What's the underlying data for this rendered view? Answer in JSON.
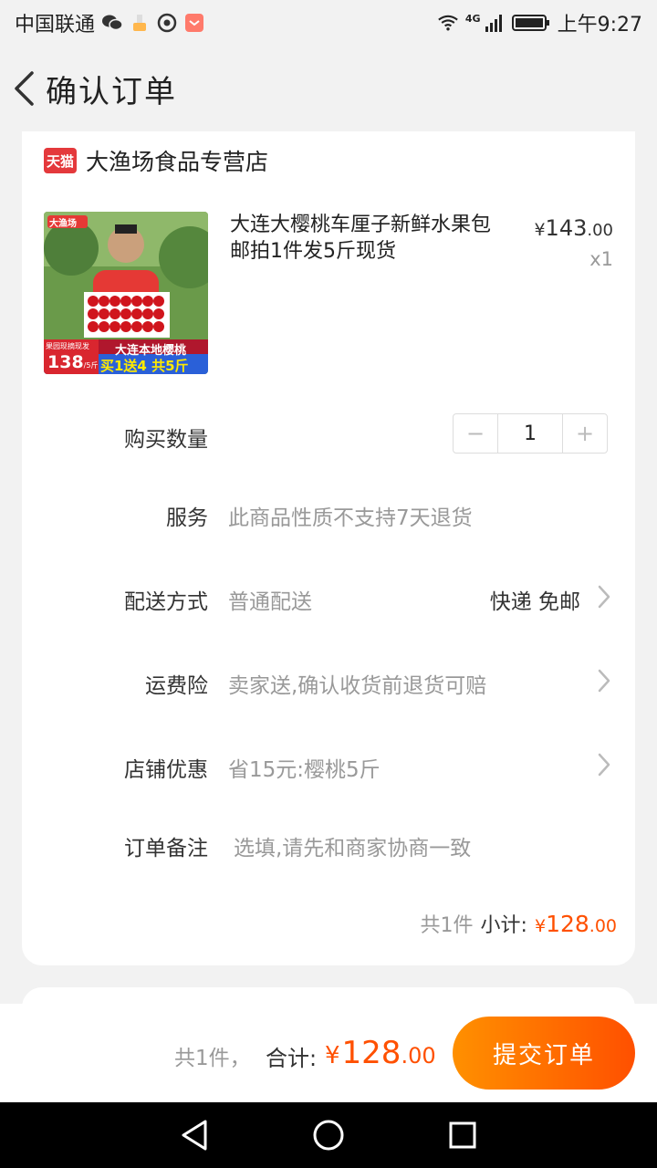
{
  "status_bar": {
    "carrier": "中国联通",
    "network": "4G",
    "time": "上午9:27"
  },
  "header": {
    "title": "确认订单"
  },
  "store": {
    "badge": "天猫",
    "name": "大渔场食品专营店"
  },
  "product": {
    "title": "大连大樱桃车厘子新鲜水果包邮拍1件发5斤现货",
    "price_symbol": "¥",
    "price_int": "143",
    "price_cents": ".00",
    "quantity_label": "x1",
    "image": {
      "brand": "大渔场",
      "banner_text": "大连本地樱桃",
      "price_tag": "138",
      "price_unit": "/5斤",
      "corner_tag": "果园现摘现发",
      "promo": "买1送4 共5斤"
    }
  },
  "rows": {
    "quantity": {
      "label": "购买数量",
      "value": "1",
      "minus": "−",
      "plus": "+"
    },
    "service": {
      "label": "服务",
      "value": "此商品性质不支持7天退货"
    },
    "delivery": {
      "label": "配送方式",
      "value": "普通配送",
      "right": "快递 免邮"
    },
    "insurance": {
      "label": "运费险",
      "value": "卖家送,确认收货前退货可赔"
    },
    "discount": {
      "label": "店铺优惠",
      "value": "省15元:樱桃5斤"
    },
    "note": {
      "label": "订单备注",
      "placeholder": "选填,请先和商家协商一致"
    }
  },
  "subtotal": {
    "count": "共1件",
    "label": "小计:",
    "symbol": "¥",
    "amount_int": "128",
    "amount_cents": ".00"
  },
  "bottom_bar": {
    "count": "共1件，",
    "label": "合计:",
    "symbol": "¥",
    "amount_int": "128",
    "amount_cents": ".00",
    "submit": "提交订单"
  },
  "colors": {
    "accent": "#ff5000",
    "tmall_red": "#e4393c",
    "gradient_start": "#ff9000"
  }
}
